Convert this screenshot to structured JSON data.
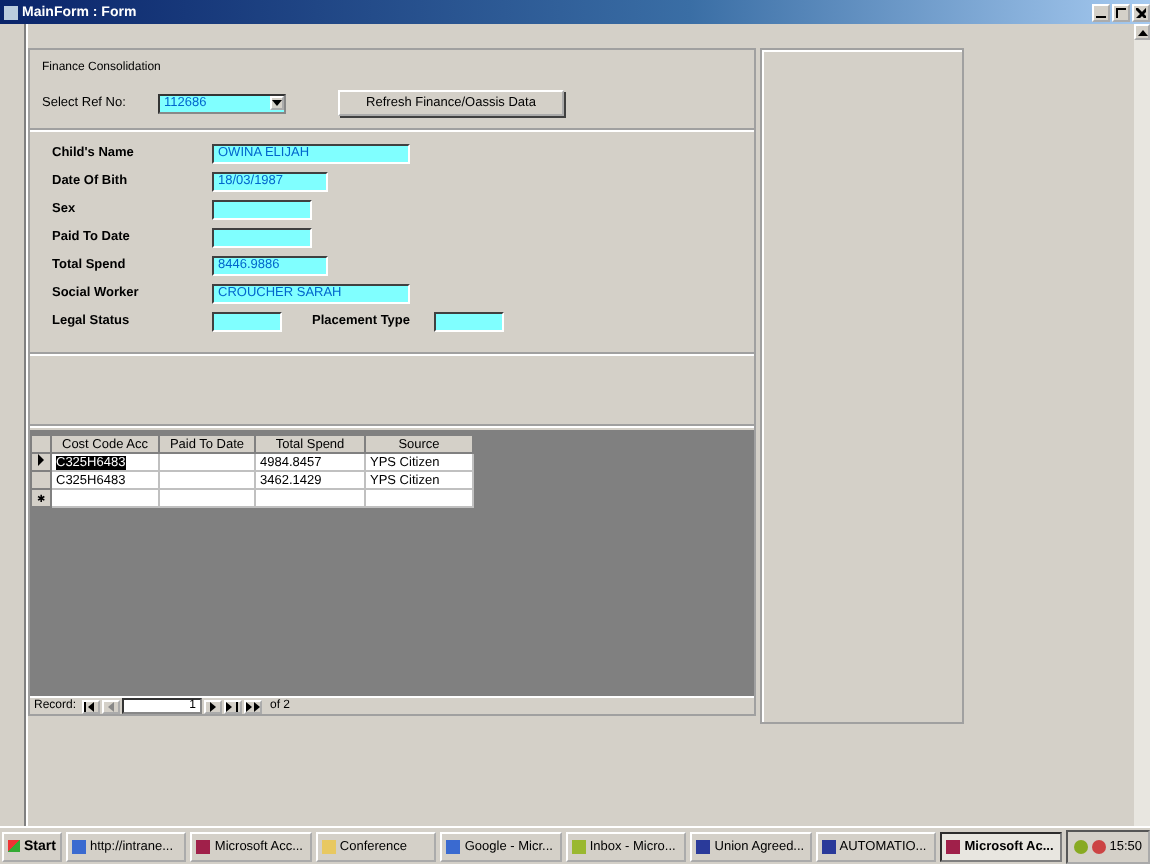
{
  "window": {
    "title": "MainForm : Form"
  },
  "header": {
    "caption": "Finance Consolidation",
    "ref_label": "Select Ref No:",
    "ref_value": "112686",
    "refresh_button": "Refresh Finance/Oassis Data"
  },
  "fields": [
    {
      "label": "Child's Name",
      "value": "OWINA ELIJAH"
    },
    {
      "label": "Date Of Bith",
      "value": "18/03/1987"
    },
    {
      "label": "Sex"
    },
    {
      "label": "Paid To Date"
    },
    {
      "label": "Total Spend",
      "value": "8446.9886"
    },
    {
      "label": "Social Worker",
      "value": "CROUCHER SARAH"
    }
  ],
  "legal_row": {
    "legal_label": "Legal Status",
    "placement_label": "Placement Type"
  },
  "datasheet": {
    "columns": [
      "Cost Code Acc",
      "Paid To Date",
      "Total Spend",
      "Source"
    ],
    "rows": [
      {
        "cells": [
          "C325H6483",
          "",
          "4984.8457",
          "YPS Citizen"
        ],
        "selected": true
      },
      {
        "cells": [
          "C325H6483",
          "",
          "3462.1429",
          "YPS Citizen"
        ],
        "selected": false
      }
    ],
    "new_row_marker": "✱"
  },
  "navigator": {
    "label": "Record:",
    "value": "1",
    "total": "of 2"
  },
  "taskbar": {
    "start": "Start",
    "tasks": [
      {
        "label": "http://intrane...",
        "selected": false
      },
      {
        "label": "Microsoft Acc...",
        "selected": false
      },
      {
        "label": "Conference",
        "selected": false
      },
      {
        "label": "Google - Micr...",
        "selected": false
      },
      {
        "label": "Inbox - Micro...",
        "selected": false
      },
      {
        "label": "Union Agreed...",
        "selected": false
      },
      {
        "label": "AUTOMATIO...",
        "selected": false
      },
      {
        "label": "Microsoft Ac...",
        "selected": true
      }
    ],
    "time": "15:50"
  }
}
